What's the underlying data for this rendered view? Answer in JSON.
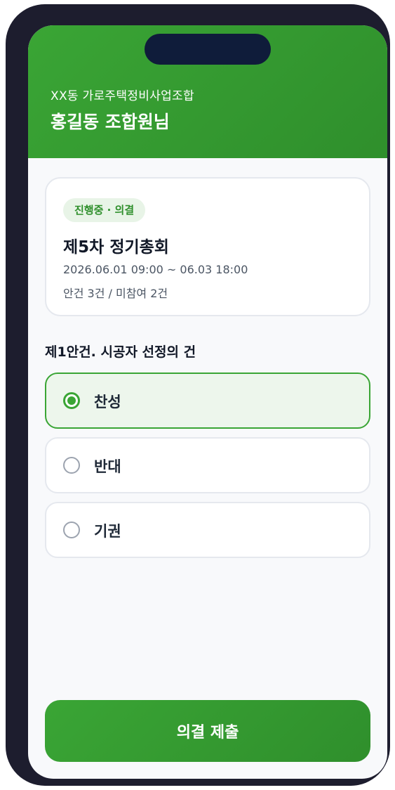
{
  "header": {
    "union_name": "XX동 가로주택정비사업조합",
    "member_name": "홍길동 조합원님"
  },
  "meeting": {
    "status_badge": "진행중 · 의결",
    "title": "제5차 정기총회",
    "period": "2026.06.01 09:00 ~ 06.03 18:00",
    "summary": "안건 3건 / 미참여 2건"
  },
  "agenda": {
    "title": "제1안건. 시공자 선정의 건",
    "options": [
      {
        "label": "찬성",
        "selected": true
      },
      {
        "label": "반대",
        "selected": false
      },
      {
        "label": "기권",
        "selected": false
      }
    ]
  },
  "submit_label": "의결 제출",
  "colors": {
    "accent": "#3aa535",
    "accent_dark": "#2f8f2c",
    "frame": "#1d1d2e",
    "notch": "#0f1c3a"
  }
}
